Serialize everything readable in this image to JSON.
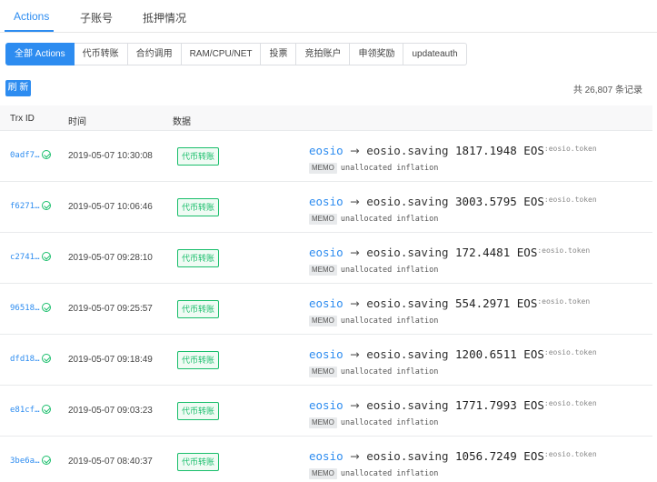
{
  "top_tabs": [
    {
      "label": "Actions",
      "active": true
    },
    {
      "label": "子账号",
      "active": false
    },
    {
      "label": "抵押情况",
      "active": false
    }
  ],
  "filters": [
    {
      "label": "全部 Actions",
      "active": true
    },
    {
      "label": "代币转账",
      "active": false
    },
    {
      "label": "合约调用",
      "active": false
    },
    {
      "label": "RAM/CPU/NET",
      "active": false
    },
    {
      "label": "投票",
      "active": false
    },
    {
      "label": "竞拍账户",
      "active": false
    },
    {
      "label": "申领奖励",
      "active": false
    },
    {
      "label": "updateauth",
      "active": false
    }
  ],
  "refresh_label": "刷 新",
  "total_label": "共 26,807 条记录",
  "table": {
    "headers": {
      "trx": "Trx ID",
      "time": "时间",
      "data": "数据"
    },
    "rows": [
      {
        "trx": "0adf7…",
        "time": "2019-05-07 10:30:08",
        "type": "代币转账",
        "from": "eosio",
        "arrow": "→",
        "to": "eosio.saving",
        "amount": "1817.1948 EOS",
        "contract": ":eosio.token",
        "memo_tag": "MEMO",
        "memo": "unallocated inflation"
      },
      {
        "trx": "f6271…",
        "time": "2019-05-07 10:06:46",
        "type": "代币转账",
        "from": "eosio",
        "arrow": "→",
        "to": "eosio.saving",
        "amount": "3003.5795 EOS",
        "contract": ":eosio.token",
        "memo_tag": "MEMO",
        "memo": "unallocated inflation"
      },
      {
        "trx": "c2741…",
        "time": "2019-05-07 09:28:10",
        "type": "代币转账",
        "from": "eosio",
        "arrow": "→",
        "to": "eosio.saving",
        "amount": "172.4481 EOS",
        "contract": ":eosio.token",
        "memo_tag": "MEMO",
        "memo": "unallocated inflation"
      },
      {
        "trx": "96518…",
        "time": "2019-05-07 09:25:57",
        "type": "代币转账",
        "from": "eosio",
        "arrow": "→",
        "to": "eosio.saving",
        "amount": "554.2971 EOS",
        "contract": ":eosio.token",
        "memo_tag": "MEMO",
        "memo": "unallocated inflation"
      },
      {
        "trx": "dfd18…",
        "time": "2019-05-07 09:18:49",
        "type": "代币转账",
        "from": "eosio",
        "arrow": "→",
        "to": "eosio.saving",
        "amount": "1200.6511 EOS",
        "contract": ":eosio.token",
        "memo_tag": "MEMO",
        "memo": "unallocated inflation"
      },
      {
        "trx": "e81cf…",
        "time": "2019-05-07 09:03:23",
        "type": "代币转账",
        "from": "eosio",
        "arrow": "→",
        "to": "eosio.saving",
        "amount": "1771.7993 EOS",
        "contract": ":eosio.token",
        "memo_tag": "MEMO",
        "memo": "unallocated inflation"
      },
      {
        "trx": "3be6a…",
        "time": "2019-05-07 08:40:37",
        "type": "代币转账",
        "from": "eosio",
        "arrow": "→",
        "to": "eosio.saving",
        "amount": "1056.7249 EOS",
        "contract": ":eosio.token",
        "memo_tag": "MEMO",
        "memo": "unallocated inflation"
      }
    ]
  },
  "colors": {
    "accent": "#2d8cf0",
    "success": "#19be6b"
  },
  "icons": {
    "status": "check-circle-icon"
  }
}
